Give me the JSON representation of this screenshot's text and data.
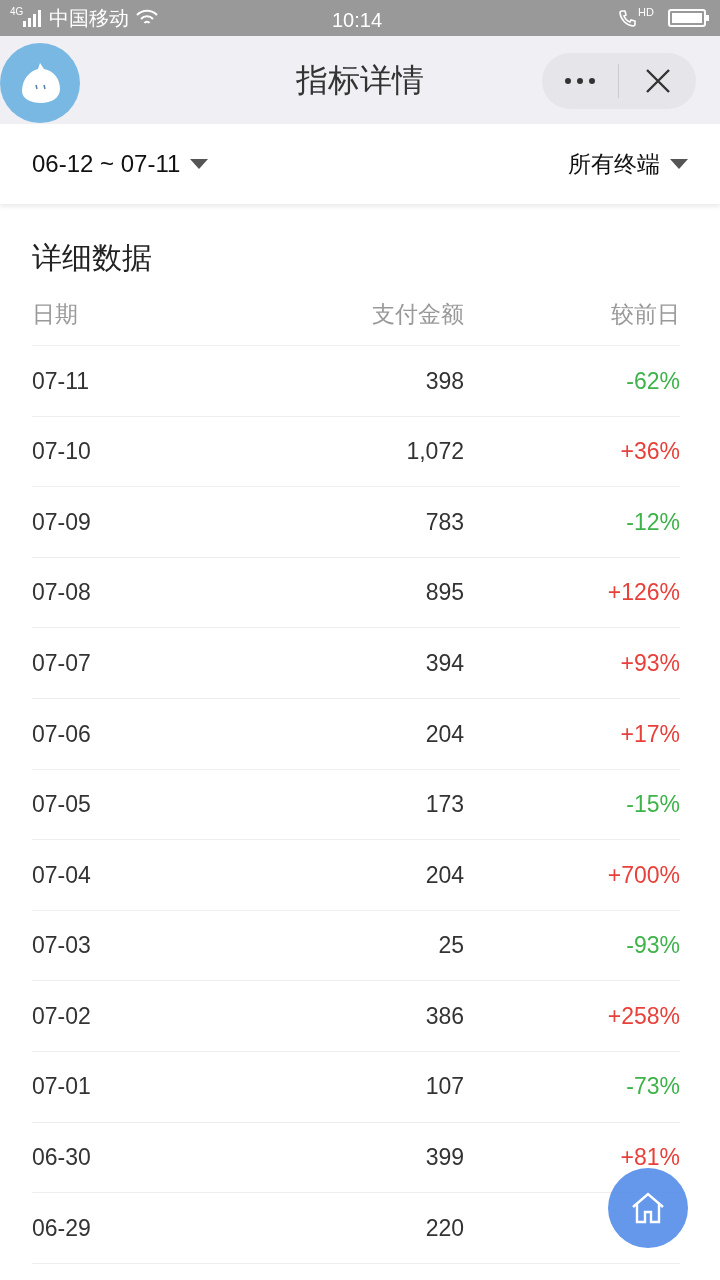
{
  "status_bar": {
    "network": "4G",
    "carrier": "中国移动",
    "time": "10:14",
    "hd": "HD"
  },
  "nav": {
    "title": "指标详情"
  },
  "filters": {
    "date_range": "06-12 ~ 07-11",
    "terminal": "所有终端"
  },
  "section_title": "详细数据",
  "table": {
    "columns": [
      "日期",
      "支付金额",
      "较前日"
    ],
    "rows": [
      {
        "date": "07-11",
        "amount": "398",
        "change": "-62%",
        "rising": false
      },
      {
        "date": "07-10",
        "amount": "1,072",
        "change": "+36%",
        "rising": true
      },
      {
        "date": "07-09",
        "amount": "783",
        "change": "-12%",
        "rising": false
      },
      {
        "date": "07-08",
        "amount": "895",
        "change": "+126%",
        "rising": true
      },
      {
        "date": "07-07",
        "amount": "394",
        "change": "+93%",
        "rising": true
      },
      {
        "date": "07-06",
        "amount": "204",
        "change": "+17%",
        "rising": true
      },
      {
        "date": "07-05",
        "amount": "173",
        "change": "-15%",
        "rising": false
      },
      {
        "date": "07-04",
        "amount": "204",
        "change": "+700%",
        "rising": true
      },
      {
        "date": "07-03",
        "amount": "25",
        "change": "-93%",
        "rising": false
      },
      {
        "date": "07-02",
        "amount": "386",
        "change": "+258%",
        "rising": true
      },
      {
        "date": "07-01",
        "amount": "107",
        "change": "-73%",
        "rising": false
      },
      {
        "date": "06-30",
        "amount": "399",
        "change": "+81%",
        "rising": true
      },
      {
        "date": "06-29",
        "amount": "220"
      }
    ]
  }
}
